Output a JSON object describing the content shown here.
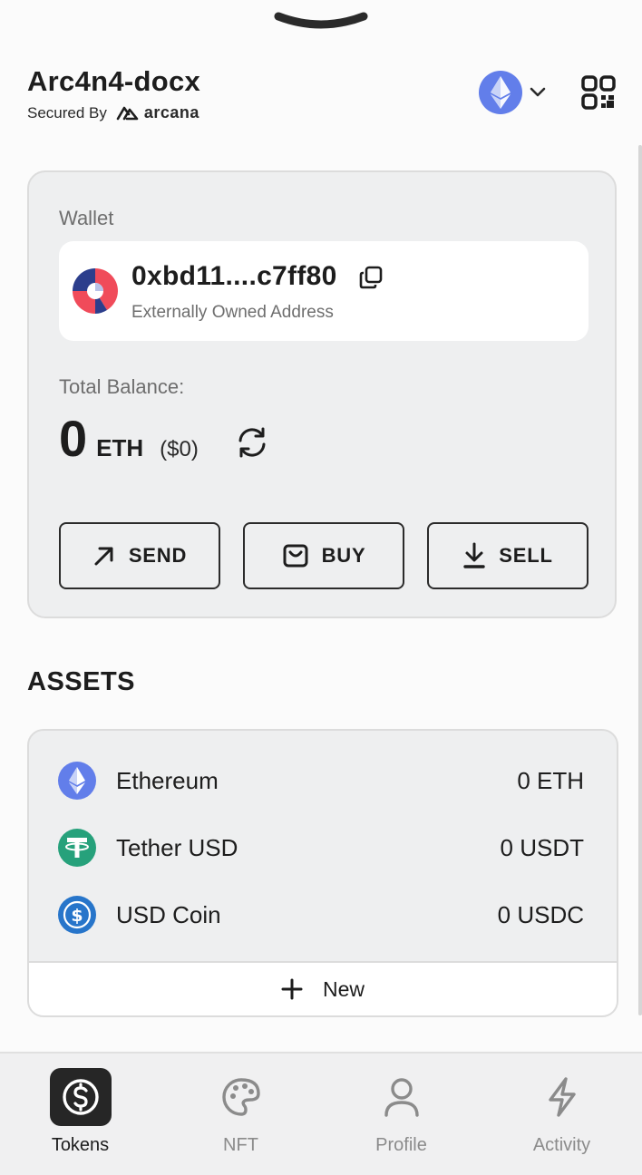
{
  "header": {
    "app_name": "Arc4n4-docx",
    "secured_by": "Secured By",
    "brand": "arcana",
    "network_icon": "ethereum-icon",
    "colors": {
      "ethereum": "#627eea"
    }
  },
  "wallet": {
    "label": "Wallet",
    "address": "0xbd11....c7ff80",
    "address_type": "Externally Owned Address",
    "balance_label": "Total Balance:",
    "balance_amount": "0",
    "balance_unit": "ETH",
    "balance_usd": "($0)"
  },
  "actions": [
    {
      "label": "SEND",
      "icon": "arrow-up-right-icon"
    },
    {
      "label": "BUY",
      "icon": "bag-icon"
    },
    {
      "label": "SELL",
      "icon": "download-icon"
    }
  ],
  "assets": {
    "title": "ASSETS",
    "items": [
      {
        "name": "Ethereum",
        "balance": "0 ETH",
        "icon": "ethereum-icon",
        "color": "#627eea"
      },
      {
        "name": "Tether USD",
        "balance": "0 USDT",
        "icon": "tether-icon",
        "color": "#26a17b"
      },
      {
        "name": "USD Coin",
        "balance": "0 USDC",
        "icon": "usd-coin-icon",
        "color": "#2775ca"
      }
    ],
    "new_label": "New"
  },
  "nav": [
    {
      "label": "Tokens",
      "icon": "dollar-coin-icon",
      "active": true
    },
    {
      "label": "NFT",
      "icon": "palette-icon",
      "active": false
    },
    {
      "label": "Profile",
      "icon": "user-icon",
      "active": false
    },
    {
      "label": "Activity",
      "icon": "lightning-icon",
      "active": false
    }
  ]
}
